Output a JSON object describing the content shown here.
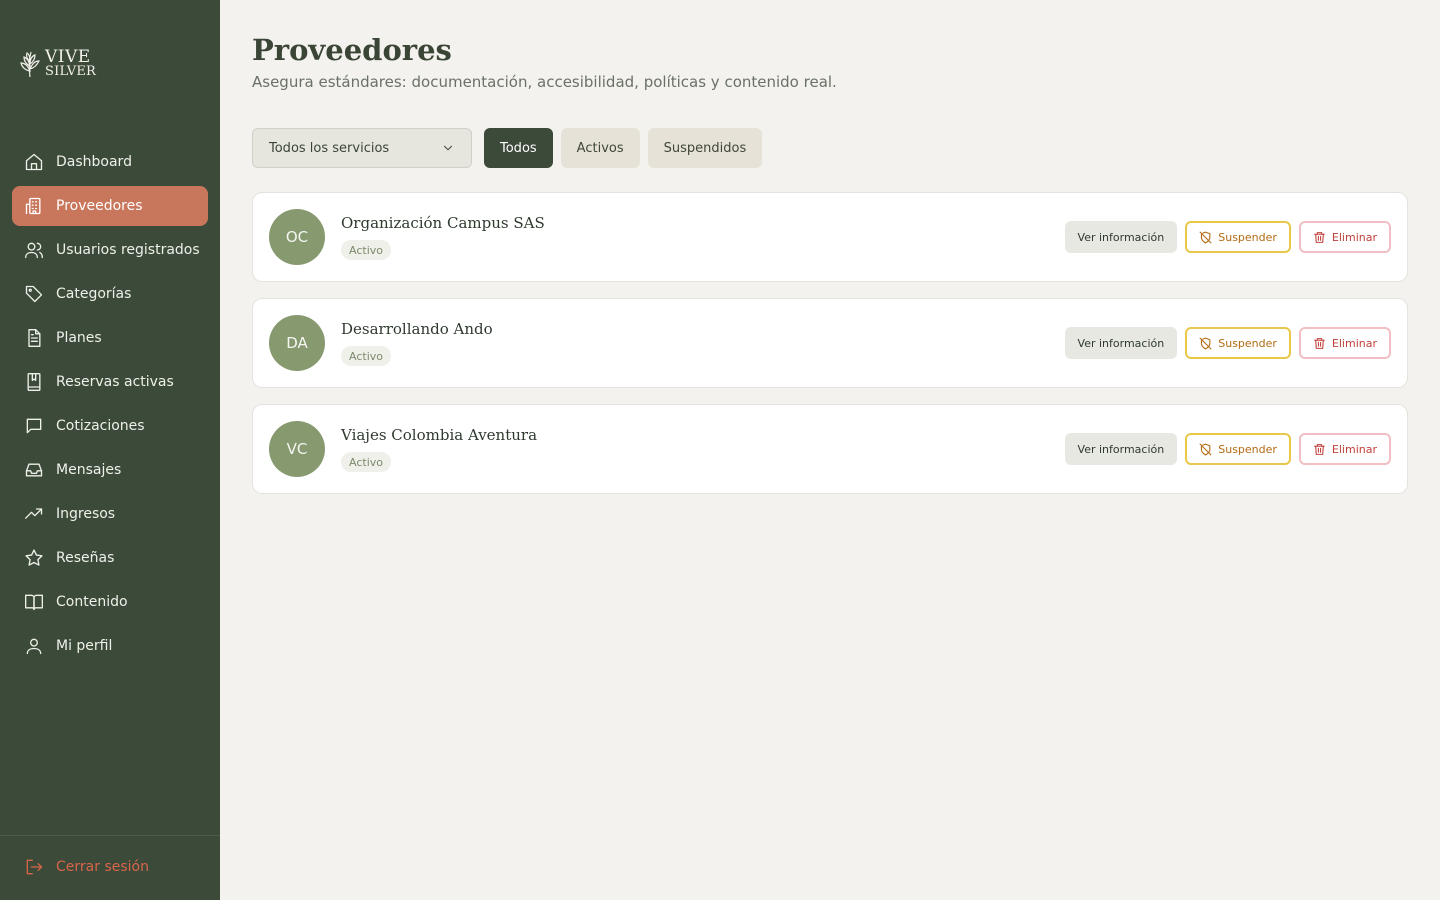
{
  "brand": {
    "logo_alt": "Vive Silver",
    "line1": "VIVE",
    "line2": "SILVER"
  },
  "sidebar": {
    "items": [
      {
        "label": "Dashboard",
        "icon": "home-icon",
        "active": false
      },
      {
        "label": "Proveedores",
        "icon": "building-icon",
        "active": true
      },
      {
        "label": "Usuarios registrados",
        "icon": "users-icon",
        "active": false
      },
      {
        "label": "Categorías",
        "icon": "tag-icon",
        "active": false
      },
      {
        "label": "Planes",
        "icon": "document-icon",
        "active": false
      },
      {
        "label": "Reservas activas",
        "icon": "bookmark-book-icon",
        "active": false
      },
      {
        "label": "Cotizaciones",
        "icon": "chat-icon",
        "active": false
      },
      {
        "label": "Mensajes",
        "icon": "inbox-icon",
        "active": false
      },
      {
        "label": "Ingresos",
        "icon": "trending-up-icon",
        "active": false
      },
      {
        "label": "Reseñas",
        "icon": "star-icon",
        "active": false
      },
      {
        "label": "Contenido",
        "icon": "book-open-icon",
        "active": false
      },
      {
        "label": "Mi perfil",
        "icon": "user-icon",
        "active": false
      }
    ],
    "logout_label": "Cerrar sesión"
  },
  "header": {
    "title": "Proveedores",
    "subtitle": "Asegura estándares: documentación, accesibilidad, políticas y contenido real."
  },
  "filters": {
    "service_select": "Todos los servicios",
    "tabs": [
      {
        "label": "Todos",
        "active": true
      },
      {
        "label": "Activos",
        "active": false
      },
      {
        "label": "Suspendidos",
        "active": false
      }
    ]
  },
  "providers": [
    {
      "initials": "OC",
      "name": "Organización Campus SAS",
      "status": "Activo"
    },
    {
      "initials": "DA",
      "name": "Desarrollando Ando",
      "status": "Activo"
    },
    {
      "initials": "VC",
      "name": "Viajes Colombia Aventura",
      "status": "Activo"
    }
  ],
  "actions": {
    "info_label": "Ver información",
    "suspend_label": "Suspender",
    "delete_label": "Eliminar"
  },
  "colors": {
    "sidebar_bg": "#3c4a3a",
    "active_nav": "#c9775c",
    "page_bg": "#f3f2ee",
    "avatar_bg": "#87996f",
    "suspend_border": "#e8c84a",
    "delete_border": "#f1bfc3",
    "logout_text": "#d86549"
  }
}
